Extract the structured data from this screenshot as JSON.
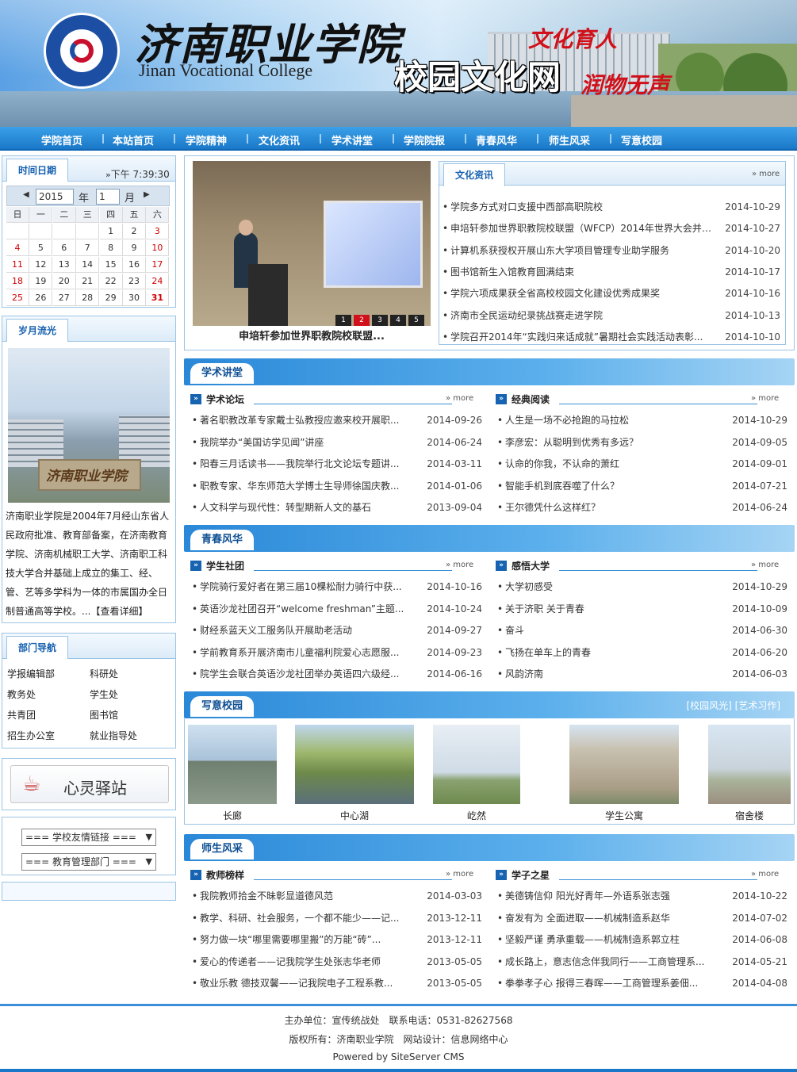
{
  "header": {
    "title": "济南职业学院",
    "subtitle": "Jinan Vocational College",
    "logo_text": "济南职业学院 Jinan Vocational College",
    "site_name": "校园文化网",
    "slogan_1": "文化育人",
    "slogan_2": "润物无声"
  },
  "nav": [
    "学院首页",
    "本站首页",
    "学院精神",
    "文化资讯",
    "学术讲堂",
    "学院院报",
    "青春风华",
    "师生风采",
    "写意校园"
  ],
  "sidebar": {
    "time_tab": "时间日期",
    "time_now": "下午 7:39:30",
    "time_arrow": "»",
    "calendar": {
      "year": "2015",
      "year_label": "年",
      "month": "1",
      "month_label": "月",
      "prev": "◀",
      "next": "▶",
      "weekdays": [
        "日",
        "一",
        "二",
        "三",
        "四",
        "五",
        "六"
      ],
      "days": [
        "",
        "",
        "",
        "",
        "1",
        "2",
        "3",
        "4",
        "5",
        "6",
        "7",
        "8",
        "9",
        "10",
        "11",
        "12",
        "13",
        "14",
        "15",
        "16",
        "17",
        "18",
        "19",
        "20",
        "21",
        "22",
        "23",
        "24",
        "25",
        "26",
        "27",
        "28",
        "29",
        "30",
        "31"
      ],
      "today": "31"
    },
    "history_tab": "岁月流光",
    "history_text": "济南职业学院是2004年7月经山东省人民政府批准、教育部备案，在济南教育学院、济南机械职工大学、济南职工科技大学合并基础上成立的集工、经、管、艺等多学科为一体的市属国办全日制普通高等学校。...【查看详细】",
    "dept_tab": "部门导航",
    "depts": [
      "学报编辑部",
      "科研处",
      "教务处",
      "学生处",
      "共青团",
      "图书馆",
      "招生办公室",
      "就业指导处"
    ],
    "xinling": "心灵驿站",
    "select_links": "=== 学校友情链接 ===",
    "select_depts": "=== 教育管理部门 ==="
  },
  "slideshow": {
    "caption": "申培轩参加世界职教院校联盟...",
    "pages": [
      "1",
      "2",
      "3",
      "4",
      "5"
    ],
    "active": "2"
  },
  "culture_news": {
    "tab": "文化资讯",
    "more": "more",
    "items": [
      {
        "title": "学院多方式对口支援中西部高职院校",
        "date": "2014-10-29"
      },
      {
        "title": "申培轩参加世界职教院校联盟（WFCP）2014年世界大会并在...",
        "date": "2014-10-27"
      },
      {
        "title": "计算机系获授权开展山东大学项目管理专业助学服务",
        "date": "2014-10-20"
      },
      {
        "title": "图书馆新生入馆教育圆满结束",
        "date": "2014-10-17"
      },
      {
        "title": "学院六项成果获全省高校校园文化建设优秀成果奖",
        "date": "2014-10-16"
      },
      {
        "title": "济南市全民运动纪录挑战赛走进学院",
        "date": "2014-10-13"
      },
      {
        "title": "学院召开2014年“实践归来话成就”暑期社会实践活动表彰...",
        "date": "2014-10-10"
      }
    ]
  },
  "sections": {
    "lecture": {
      "title": "学术讲堂",
      "left": {
        "title": "学术论坛",
        "more": "more",
        "items": [
          {
            "title": "著名职教改革专家戴士弘教授应邀来校开展职...",
            "date": "2014-09-26"
          },
          {
            "title": "我院举办“美国访学见闻”讲座",
            "date": "2014-06-24"
          },
          {
            "title": "阳春三月话读书——我院举行北文论坛专题讲...",
            "date": "2014-03-11"
          },
          {
            "title": "职教专家、华东师范大学博士生导师徐国庆教...",
            "date": "2014-01-06"
          },
          {
            "title": "人文科学与现代性：转型期新人文的基石",
            "date": "2013-09-04"
          }
        ]
      },
      "right": {
        "title": "经典阅读",
        "more": "more",
        "items": [
          {
            "title": "人生是一场不必抢跑的马拉松",
            "date": "2014-10-29"
          },
          {
            "title": "李彦宏：从聪明到优秀有多远？",
            "date": "2014-09-05"
          },
          {
            "title": "认命的你我，不认命的萧红",
            "date": "2014-09-01"
          },
          {
            "title": "智能手机到底吞噬了什么？",
            "date": "2014-07-21"
          },
          {
            "title": "王尔德凭什么这样红？",
            "date": "2014-06-24"
          }
        ]
      }
    },
    "youth": {
      "title": "青春风华",
      "left": {
        "title": "学生社团",
        "more": "more",
        "items": [
          {
            "title": "学院骑行爱好者在第三届10棵松耐力骑行中获...",
            "date": "2014-10-16"
          },
          {
            "title": "英语沙龙社团召开“welcome freshman”主题...",
            "date": "2014-10-24"
          },
          {
            "title": "财经系蓝天义工服务队开展助老活动",
            "date": "2014-09-27"
          },
          {
            "title": "学前教育系开展济南市儿童福利院爱心志愿服...",
            "date": "2014-09-23"
          },
          {
            "title": "院学生会联合英语沙龙社团举办英语四六级经...",
            "date": "2014-06-16"
          }
        ]
      },
      "right": {
        "title": "感悟大学",
        "more": "more",
        "items": [
          {
            "title": "大学初感受",
            "date": "2014-10-29"
          },
          {
            "title": "关于济职 关于青春",
            "date": "2014-10-09"
          },
          {
            "title": "奋斗",
            "date": "2014-06-30"
          },
          {
            "title": "飞扬在单车上的青春",
            "date": "2014-06-20"
          },
          {
            "title": "风韵济南",
            "date": "2014-06-03"
          }
        ]
      }
    },
    "campus": {
      "title": "写意校园",
      "links": "[校园风光] [艺术习作]",
      "photos": [
        "长廊",
        "中心湖",
        "屹然",
        "学生公寓",
        "宿舍楼"
      ]
    },
    "staff": {
      "title": "师生风采",
      "left": {
        "title": "教师榜样",
        "more": "more",
        "items": [
          {
            "title": "我院教师拾金不昧彰显道德风范",
            "date": "2014-03-03"
          },
          {
            "title": "教学、科研、社会服务，一个都不能少——记...",
            "date": "2013-12-11"
          },
          {
            "title": "努力做一块“哪里需要哪里搬”的万能“砖”...",
            "date": "2013-12-11"
          },
          {
            "title": "爱心的传递者——记我院学生处张志华老师",
            "date": "2013-05-05"
          },
          {
            "title": "敬业乐教 德技双馨——记我院电子工程系教...",
            "date": "2013-05-05"
          }
        ]
      },
      "right": {
        "title": "学子之星",
        "more": "more",
        "items": [
          {
            "title": "美德铸信仰 阳光好青年—外语系张志强",
            "date": "2014-10-22"
          },
          {
            "title": "奋发有为 全面进取——机械制造系赵华",
            "date": "2014-07-02"
          },
          {
            "title": "坚毅严谨 勇承重载——机械制造系郭立柱",
            "date": "2014-06-08"
          },
          {
            "title": "成长路上，意志信念伴我同行——工商管理系...",
            "date": "2014-05-21"
          },
          {
            "title": "拳拳孝子心 报得三春晖——工商管理系姜佃...",
            "date": "2014-04-08"
          }
        ]
      }
    }
  },
  "footer": {
    "line1": "主办单位：宣传统战处　联系电话：0531-82627568",
    "line2": "版权所有：济南职业学院　网站设计：信息网络中心",
    "line3": "Powered by SiteServer CMS"
  },
  "colors": {
    "nav": "#1a78c8",
    "accent": "#1663b2",
    "border": "#9cc4e4",
    "weekend": "#d00000"
  }
}
